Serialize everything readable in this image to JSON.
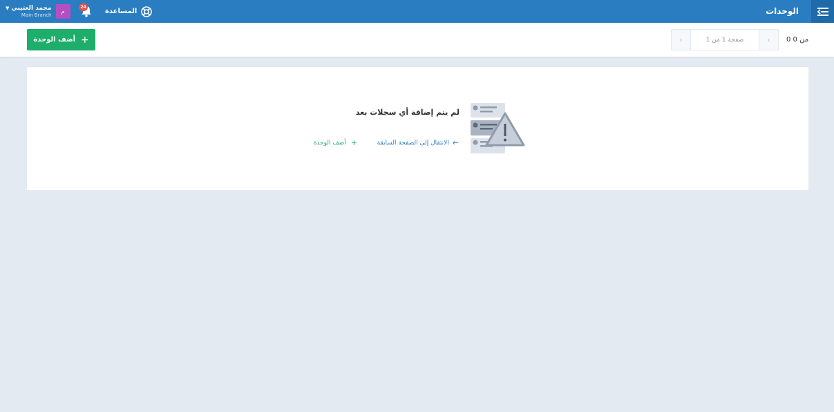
{
  "header": {
    "page_title": "الوحدات",
    "menu_icon": "menu-collapse-icon",
    "help_label": "المساعدة",
    "help_icon": "lifebuoy-icon",
    "notifications": {
      "icon": "bell-icon",
      "count": "24"
    },
    "user": {
      "name": "محمد العتيبي",
      "branch": "Main Branch",
      "avatar_letter": "م",
      "avatar_color": "#b44fc3"
    },
    "colors": {
      "bar": "#2a7dc0",
      "menu_button": "#1f6aa8"
    }
  },
  "toolbar": {
    "add_button_label": "أضف الوحدة",
    "add_button_color": "#1cae6a",
    "pagination": {
      "page_text": "صفحة 1 من 1",
      "prev_icon": "chevron-left-icon",
      "next_icon": "chevron-right-icon"
    },
    "count_text": "0 من 0"
  },
  "empty_state": {
    "icon": "server-warning-icon",
    "title": "لم يتم إضافة أي سجلات بعد",
    "back_link_label": "الانتقال إلى الصفحة السابقة",
    "add_link_label": "أضف الوحدة"
  }
}
